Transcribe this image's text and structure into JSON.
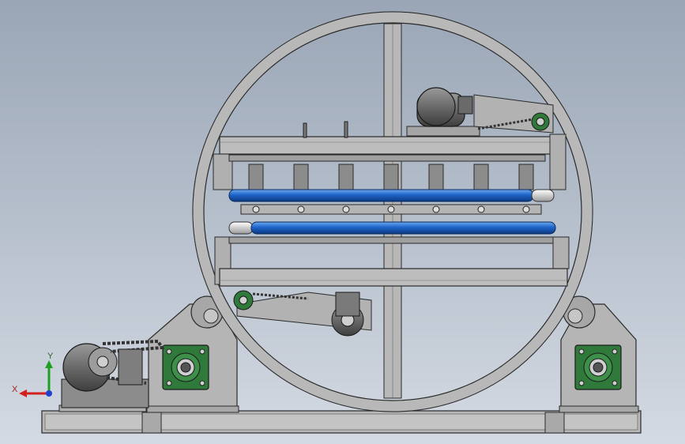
{
  "viewport": {
    "background_top": "#9aa6b6",
    "background_bottom": "#d4dae3"
  },
  "colors": {
    "steel": "#b8b8b8",
    "steel_dark": "#8a8a8a",
    "outline": "#2a2a2a",
    "roller_blue": "#1e64c8",
    "roller_highlight": "#6aa8f0",
    "bearing_green": "#2f7a3a",
    "axis_x": "#d02020",
    "axis_y": "#20a020",
    "axis_z": "#2040d0"
  },
  "triad": {
    "x_label": "X",
    "y_label": "Y"
  }
}
